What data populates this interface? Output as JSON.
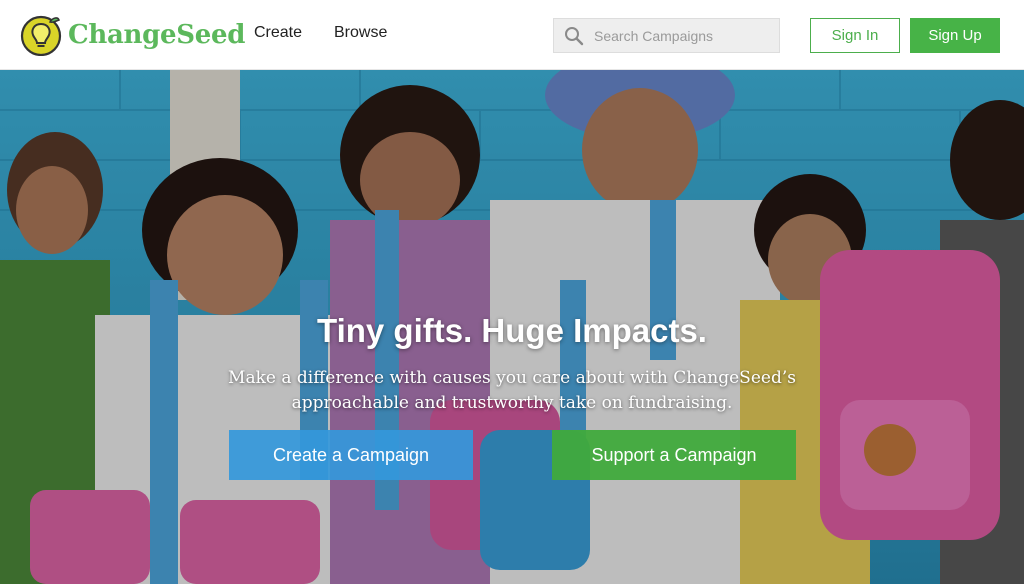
{
  "brand": {
    "name": "ChangeSeed",
    "color": "#5cb85c",
    "logo_icon": "seed-lightbulb-icon"
  },
  "nav": {
    "items": [
      {
        "label": "Create"
      },
      {
        "label": "Browse"
      }
    ]
  },
  "search": {
    "placeholder": "Search Campaigns",
    "value": "",
    "icon": "search-icon"
  },
  "auth": {
    "sign_in_label": "Sign In",
    "sign_up_label": "Sign Up"
  },
  "hero": {
    "image": "photo of smiling children with backpacks in front of a blue wall",
    "title": "Tiny gifts. Huge Impacts.",
    "subtitle": "Make a difference with causes you care about with ChangeSeed’s approachable and trustworthy take on fundraising.",
    "create_label": "Create a Campaign",
    "support_label": "Support a Campaign"
  },
  "colors": {
    "accent_green": "#47b347",
    "accent_blue": "#3498db"
  }
}
